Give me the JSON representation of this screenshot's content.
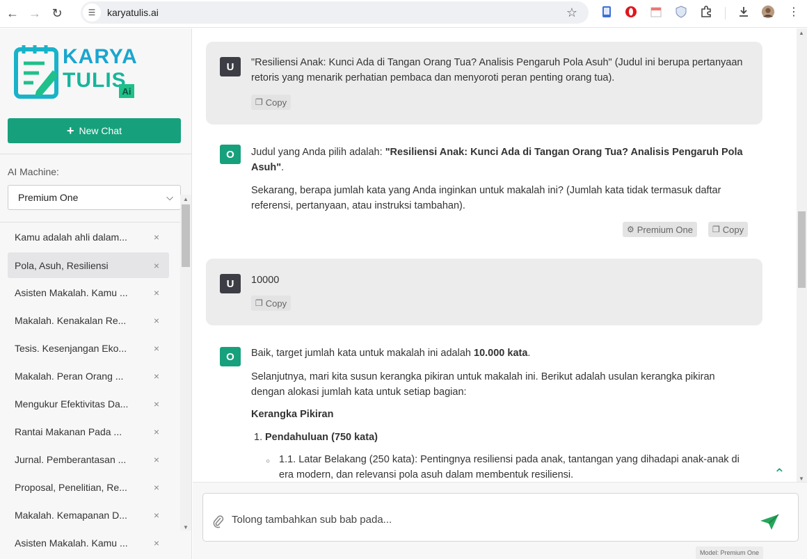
{
  "browser": {
    "url": "karyatulis.ai"
  },
  "sidebar": {
    "logo_line1": "KARYA",
    "logo_line2": "TULIS",
    "logo_badge": "Ai",
    "new_chat_label": "New Chat",
    "machine_label": "AI Machine:",
    "machine_selected": "Premium One",
    "history": [
      {
        "label": "Kamu adalah ahli dalam..."
      },
      {
        "label": "Pola, Asuh, Resiliensi"
      },
      {
        "label": "Asisten Makalah. Kamu ..."
      },
      {
        "label": "Makalah. Kenakalan Re..."
      },
      {
        "label": "Tesis. Kesenjangan Eko..."
      },
      {
        "label": "Makalah. Peran Orang ..."
      },
      {
        "label": "Mengukur Efektivitas Da..."
      },
      {
        "label": "Rantai Makanan Pada ..."
      },
      {
        "label": "Jurnal. Pemberantasan ..."
      },
      {
        "label": "Proposal, Penelitian, Re..."
      },
      {
        "label": "Makalah. Kemapanan D..."
      },
      {
        "label": "Asisten Makalah. Kamu ..."
      }
    ],
    "close_glyph": "×"
  },
  "chat": {
    "msg1": {
      "avatar": "U",
      "text": "\"Resiliensi Anak: Kunci Ada di Tangan Orang Tua? Analisis Pengaruh Pola Asuh\" (Judul ini berupa pertanyaan retoris yang menarik perhatian pembaca dan menyoroti peran penting orang tua).",
      "copy_label": "Copy"
    },
    "msg2": {
      "avatar": "O",
      "p1_prefix": "Judul yang Anda pilih adalah: ",
      "p1_bold": "\"Resiliensi Anak: Kunci Ada di Tangan Orang Tua? Analisis Pengaruh Pola Asuh\"",
      "p1_suffix": ".",
      "p2": "Sekarang, berapa jumlah kata yang Anda inginkan untuk makalah ini? (Jumlah kata tidak termasuk daftar referensi, pertanyaan, atau instruksi tambahan).",
      "model_label": "Premium One",
      "copy_label": "Copy"
    },
    "msg3": {
      "avatar": "U",
      "text": "10000",
      "copy_label": "Copy"
    },
    "msg4": {
      "avatar": "O",
      "p1_prefix": "Baik, target jumlah kata untuk makalah ini adalah ",
      "p1_bold": "10.000 kata",
      "p1_suffix": ".",
      "p2": "Selanjutnya, mari kita susun kerangka pikiran untuk makalah ini. Berikut adalah usulan kerangka pikiran dengan alokasi jumlah kata untuk setiap bagian:",
      "heading": "Kerangka Pikiran",
      "item1_num": "1.",
      "item1": "Pendahuluan (750 kata)",
      "sub1": "1.1. Latar Belakang (250 kata): Pentingnya resiliensi pada anak, tantangan yang dihadapi anak-anak di era modern, dan relevansi pola asuh dalam membentuk resiliensi."
    }
  },
  "input": {
    "value": "Tolong tambahkan sub bab pada...",
    "model_footer": "Model: Premium One"
  }
}
